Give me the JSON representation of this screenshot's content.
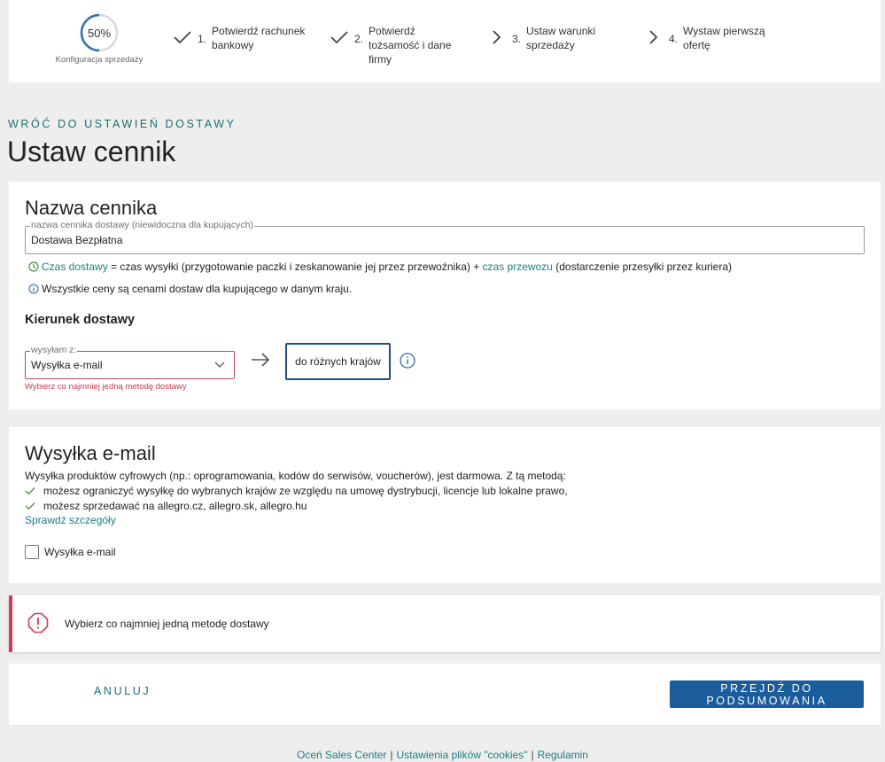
{
  "progress": {
    "percent_label": "50%",
    "percent": 0.5,
    "caption": "Konfiguracja sprzedaży",
    "steps": [
      {
        "num": "1.",
        "label": "Potwierdź rachunek bankowy",
        "state": "done"
      },
      {
        "num": "2.",
        "label": "Potwierdź tożsamość i dane firmy",
        "state": "done"
      },
      {
        "num": "3.",
        "label": "Ustaw warunki sprzedaży",
        "state": "pending"
      },
      {
        "num": "4.",
        "label": "Wystaw pierwszą ofertę",
        "state": "pending"
      }
    ]
  },
  "header": {
    "back_link": "WRÓĆ DO USTAWIEŃ DOSTAWY",
    "title": "Ustaw cennik"
  },
  "name_section": {
    "title": "Nazwa cennika",
    "field_legend": "nazwa cennika dostawy (niewidoczna dla kupujących)",
    "field_value": "Dostawa Bezpłatna",
    "info1": {
      "link1": "Czas dostawy",
      "text1": " = czas wysyłki (przygotowanie paczki i zeskanowanie jej przez przewoźnika) + ",
      "link2": "czas przewozu",
      "text2": " (dostarczenie przesyłki przez kuriera)"
    },
    "info2": "Wszystkie ceny są cenami dostaw dla kupującego w danym kraju."
  },
  "direction": {
    "title": "Kierunek dostawy",
    "from_legend": "wysyłam z:",
    "from_value": "Wysyłka e-mail",
    "error": "Wybierz co najmniej jedną metodę dostawy",
    "to_button": "do różnych krajów"
  },
  "email_section": {
    "title": "Wysyłka e-mail",
    "description": "Wysyłka produktów cyfrowych (np.: oprogramowania, kodów do serwisów, voucherów), jest darmowa. Z tą metodą:",
    "bullets": [
      "możesz ograniczyć wysyłkę do wybranych krajów ze względu na umowę dystrybucji, licencje lub lokalne prawo,",
      "możesz sprzedawać na allegro.cz, allegro.sk, allegro.hu"
    ],
    "details_link": "Sprawdź szczegóły",
    "checkbox_label": "Wysyłka e-mail",
    "checkbox_checked": false
  },
  "alert": {
    "text": "Wybierz co najmniej jedną metodę dostawy"
  },
  "actions": {
    "cancel": "ANULUJ",
    "submit": "PRZEJDŹ DO PODSUMOWANIA"
  },
  "footer": {
    "links": [
      "Oceń Sales Center",
      "Ustawienia plików \"cookies\"",
      "Regulamin"
    ],
    "separator": "|"
  },
  "colors": {
    "accent_teal": "#1a7e86",
    "primary_blue": "#1a5c9c",
    "error_red": "#d23b5a",
    "ring_blue": "#2f6fb3"
  }
}
